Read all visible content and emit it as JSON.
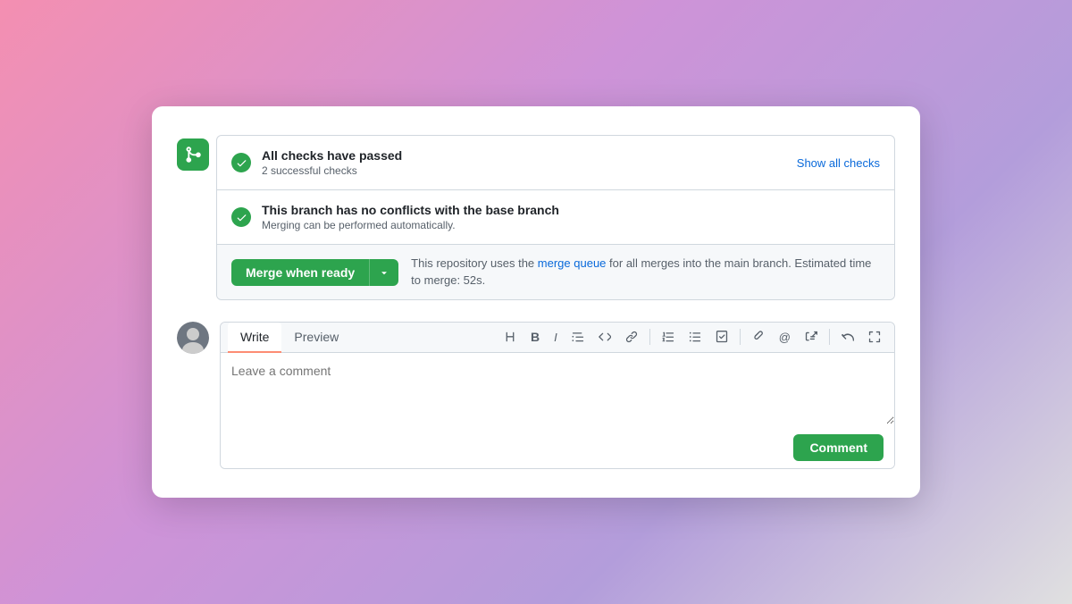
{
  "checks": {
    "check1": {
      "title": "All checks have passed",
      "subtitle": "2 successful checks",
      "show_all": "Show all checks"
    },
    "check2": {
      "title": "This branch has no conflicts with the base branch",
      "subtitle": "Merging can be performed automatically."
    }
  },
  "merge": {
    "button_label": "Merge when ready",
    "info_prefix": "This repository uses the",
    "info_link": "merge queue",
    "info_suffix": "for all merges into the main branch. Estimated time to merge: 52s."
  },
  "comment": {
    "write_tab": "Write",
    "preview_tab": "Preview",
    "placeholder": "Leave a comment",
    "submit_label": "Comment"
  },
  "toolbar": {
    "h": "H",
    "b": "B",
    "i": "I",
    "quote": "❝",
    "code": "<>",
    "link": "🔗",
    "ol": "1.",
    "ul": "•",
    "task": "☑",
    "attach": "📎",
    "mention": "@",
    "ref": "↗",
    "undo": "↩",
    "fullscreen": "⤢"
  }
}
